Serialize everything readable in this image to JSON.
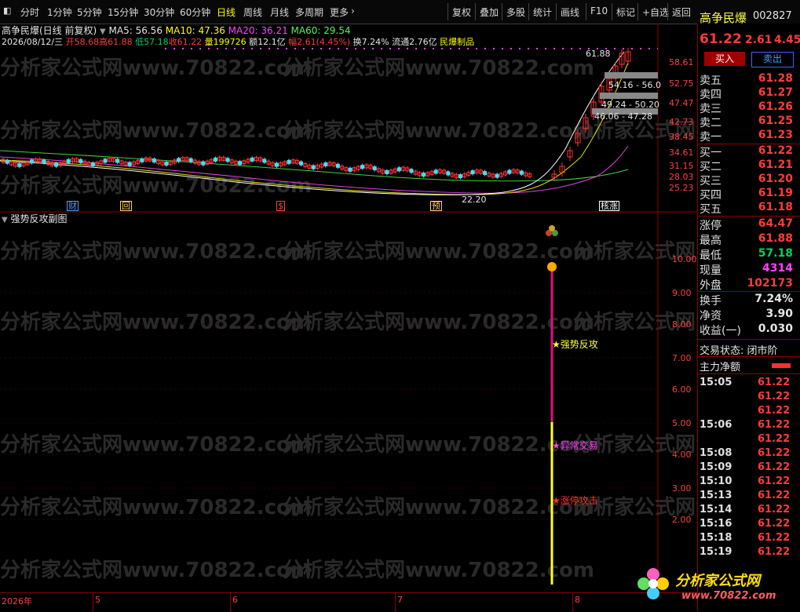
{
  "toolbar": {
    "left_items": [
      "分时",
      "1分钟",
      "5分钟",
      "15分钟",
      "30分钟",
      "60分钟",
      "日线",
      "周线",
      "月线",
      "多周期",
      "更多"
    ],
    "active": "日线",
    "right_items": [
      "复权",
      "叠加",
      "多股",
      "统计",
      "画线",
      "F10",
      "标记",
      "+自选",
      "返回"
    ]
  },
  "chart_header": {
    "title": "高争民爆(日线 前复权)",
    "ma5": "MA5: 56.56",
    "ma10": "MA10: 47.36",
    "ma20": "MA20: 36.21",
    "ma60": "MA60: 29.54",
    "date": "2026/08/12/三",
    "open": "开58.68",
    "high": "高61.88",
    "low": "低57.18",
    "close": "收61.22",
    "volume": "量199726",
    "amount": "额12.1亿",
    "change": "幅2.61(4.45%)",
    "turnover": "换7.24%",
    "float": "流通2.76亿",
    "sector": "民爆制品"
  },
  "main_axis": [
    "58.61",
    "52.75",
    "47.47",
    "42.73",
    "38.45",
    "34.61",
    "31.15",
    "28.03",
    "25.23"
  ],
  "price_annotations": {
    "high_mark": "61.88",
    "low_mark": "22.20",
    "box1": "54.16 - 56.0",
    "box2": "49.24 - 50.20",
    "box3": "46.06 - 47.28"
  },
  "event_markers": [
    {
      "text": "财",
      "color": "#40a0ff"
    },
    {
      "text": "回",
      "color": "#ffcc66"
    },
    {
      "text": "$",
      "color": "#ff4040"
    },
    {
      "text": "预",
      "color": "#ffcc66"
    },
    {
      "text": "核涨",
      "color": "#ffffff"
    }
  ],
  "sub_chart": {
    "title": "强势反攻副图",
    "axis": [
      "10.00",
      "9.00",
      "8.00",
      "7.00",
      "6.00",
      "5.00",
      "4.00",
      "3.00",
      "2.00"
    ],
    "signals": [
      {
        "label": "★强势反攻",
        "color": "#ffff40"
      },
      {
        "label": "★异常交易",
        "color": "#ff40ff"
      },
      {
        "label": "★涨停攻击",
        "color": "#ff3030"
      }
    ]
  },
  "bottom_dates": [
    "2026年",
    "5",
    "6",
    "7",
    "8"
  ],
  "right_panel": {
    "name": "高争民爆",
    "code": "002827",
    "price": "61.22",
    "change": "2.61",
    "change_pct": "4.45",
    "buy_btn": "买入",
    "sell_btn": "卖出",
    "asks": [
      {
        "label": "卖五",
        "price": "61.28"
      },
      {
        "label": "卖四",
        "price": "61.27"
      },
      {
        "label": "卖三",
        "price": "61.26"
      },
      {
        "label": "卖二",
        "price": "61.25"
      },
      {
        "label": "卖一",
        "price": "61.23"
      }
    ],
    "bids": [
      {
        "label": "买一",
        "price": "61.22"
      },
      {
        "label": "买二",
        "price": "61.21"
      },
      {
        "label": "买三",
        "price": "61.20"
      },
      {
        "label": "买四",
        "price": "61.19"
      },
      {
        "label": "买五",
        "price": "61.18"
      }
    ],
    "stats": [
      {
        "label": "涨停",
        "value": "64.47",
        "color": "#ff3b3b"
      },
      {
        "label": "最高",
        "value": "61.88",
        "color": "#ff3b3b"
      },
      {
        "label": "最低",
        "value": "57.18",
        "color": "#00d060"
      },
      {
        "label": "现量",
        "value": "4314",
        "color": "#ff40ff"
      },
      {
        "label": "外盘",
        "value": "102173",
        "color": "#ff3b3b"
      }
    ],
    "stats2": [
      {
        "label": "换手",
        "value": "7.24%"
      },
      {
        "label": "净资",
        "value": "3.90"
      },
      {
        "label": "收益(一)",
        "value": "0.030"
      }
    ],
    "status_label": "交易状态: 闭市阶",
    "capital_label": "主力净额",
    "trades": [
      {
        "time": "15:05",
        "price": "61.22"
      },
      {
        "time": "",
        "price": "61.22"
      },
      {
        "time": "",
        "price": "61.22"
      },
      {
        "time": "15:06",
        "price": "61.22"
      },
      {
        "time": "",
        "price": "61.22"
      },
      {
        "time": "15:08",
        "price": "61.22"
      },
      {
        "time": "15:09",
        "price": "61.22"
      },
      {
        "time": "15:10",
        "price": "61.22"
      },
      {
        "time": "15:13",
        "price": "61.22"
      },
      {
        "time": "15:14",
        "price": "61.22"
      },
      {
        "time": "15:16",
        "price": "61.22"
      },
      {
        "time": "15:18",
        "price": "61.22"
      },
      {
        "time": "15:19",
        "price": "61.22"
      }
    ]
  },
  "watermark_text": "分析家公式网www.70822.com",
  "logo": {
    "title": "分析家公式网",
    "url": "www.70822.com"
  }
}
